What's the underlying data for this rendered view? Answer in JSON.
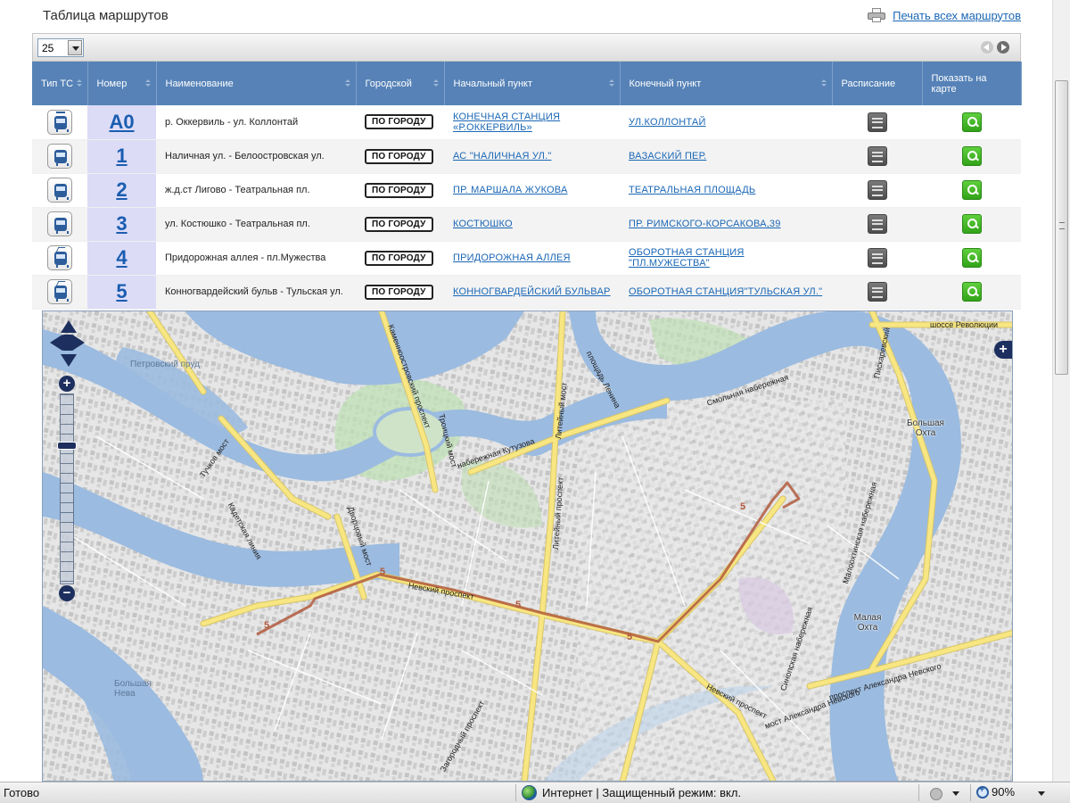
{
  "page": {
    "title": "Таблица маршрутов",
    "print_all": "Печать всех маршрутов"
  },
  "pager": {
    "page_size": "25"
  },
  "table": {
    "columns": {
      "type": "Тип ТС",
      "number": "Номер",
      "name": "Наименование",
      "city": "Городской",
      "start": "Начальный пункт",
      "end": "Конечный пункт",
      "schedule": "Расписание",
      "show_on_map": "Показать на карте"
    },
    "rows": [
      {
        "vehicle_icon": "tram-icon",
        "number": "А0",
        "name": "р. Оккервиль - ул. Коллонтай",
        "city": "ПО ГОРОДУ",
        "start": "КОНЕЧНАЯ СТАНЦИЯ «Р.ОККЕРВИЛЬ»",
        "end": "УЛ.КОЛЛОНТАЙ"
      },
      {
        "vehicle_icon": "bus-icon",
        "number": "1",
        "name": "Наличная ул. - Белоостровская ул.",
        "city": "ПО ГОРОДУ",
        "start": "АС \"НАЛИЧНАЯ УЛ.\"",
        "end": "ВАЗАСКИЙ ПЕР."
      },
      {
        "vehicle_icon": "bus-icon",
        "number": "2",
        "name": "ж.д.ст Лигово - Театральная пл.",
        "city": "ПО ГОРОДУ",
        "start": "ПР. МАРШАЛА ЖУКОВА",
        "end": "ТЕАТРАЛЬНАЯ ПЛОЩАДЬ"
      },
      {
        "vehicle_icon": "bus-icon",
        "number": "3",
        "name": "ул. Костюшко - Театральная пл.",
        "city": "ПО ГОРОДУ",
        "start": "КОСТЮШКО",
        "end": "ПР. РИМСКОГО-КОРСАКОВА,39"
      },
      {
        "vehicle_icon": "trolleybus-icon",
        "number": "4",
        "name": "Придорожная аллея - пл.Мужества",
        "city": "ПО ГОРОДУ",
        "start": "ПРИДОРОЖНАЯ АЛЛЕЯ",
        "end": "ОБОРОТНАЯ СТАНЦИЯ \"ПЛ.МУЖЕСТВА\""
      },
      {
        "vehicle_icon": "trolleybus-icon",
        "number": "5",
        "name": "Конногвардейский бульв - Тульская ул.",
        "city": "ПО ГОРОДУ",
        "start": "КОННОГВАРДЕЙСКИЙ БУЛЬВАР",
        "end": "ОБОРОТНАЯ СТАНЦИЯ\"ТУЛЬСКАЯ УЛ.\""
      }
    ]
  },
  "map": {
    "route_marker": "5",
    "labels": {
      "petrovsky": "Петровский пруд",
      "bolshaya_neva": "Большая Нева",
      "bolshaya_okhta": "Большая Охта",
      "malaya_okhta": "Малая Охта",
      "nevsky": "Невский проспект",
      "nevsky2": "Невский проспект",
      "kutuzova": "набережная Кутузова",
      "smolnaya": "Смольная набережная",
      "liteyny_most": "Литейный мост",
      "liteyny_pr": "Литейный проспект",
      "troitsky": "Троицкий мост",
      "dvortsovy": "Дворцовый мост",
      "tuchkov": "Тучков мост",
      "zagorodny": "Загородный проспект",
      "sinopskaya": "Синопская набережная",
      "aleksandra": "проспект Александра Невского",
      "shosse": "шоссе Революции",
      "piskarevsky": "Пискаревский",
      "malookhtinsky": "Малоохтинская набережная",
      "most_al": "мост Александра Невского",
      "kamennoostrovsky": "Каменноостровский проспект",
      "lenina": "площадь Ленина",
      "kadetskaya": "Кадетская линия"
    }
  },
  "statusbar": {
    "ready": "Готово",
    "zone": "Интернет | Защищенный режим: вкл.",
    "zoom": "90%"
  },
  "colors": {
    "header_bg": "#5682b7",
    "link": "#1a67b5",
    "route_line": "#b15a3d",
    "water": "#9bbbe0",
    "major_road": "#f7e681"
  }
}
